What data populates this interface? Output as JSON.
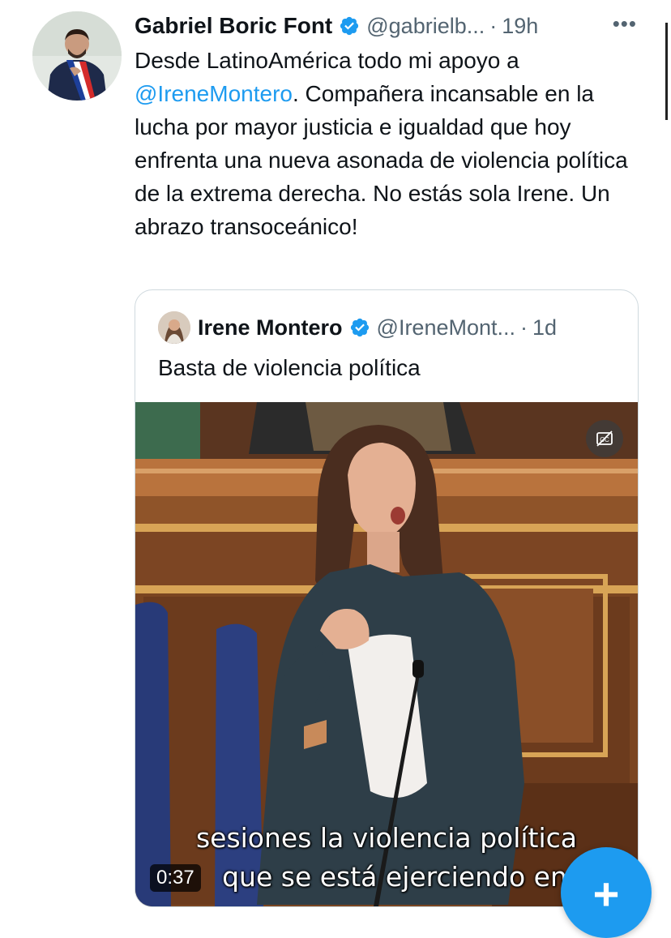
{
  "tweet": {
    "author_name": "Gabriel Boric Font",
    "author_handle": "@gabrielb...",
    "separator": "·",
    "time": "19h",
    "more": "•••",
    "text_line1": "Desde LatinoAmérica todo mi apoyo a",
    "mention": "@IreneMontero",
    "text_rest": ". Compañera incansable en la lucha por mayor justicia e igualdad que hoy enfrenta una nueva asonada de violencia política de la extrema derecha. No estás sola Irene. Un abrazo transoceánico!"
  },
  "quoted": {
    "author_name": "Irene Montero",
    "author_handle": "@IreneMont...",
    "separator": "·",
    "time": "1d",
    "text": "Basta de violencia política",
    "video": {
      "subtitle_line1": "sesiones la violencia política",
      "subtitle_line2": "que se está ejerciendo en",
      "duration": "0:37"
    }
  },
  "fab": {
    "label": "+"
  },
  "colors": {
    "accent": "#1d9bf0",
    "text": "#0f1419",
    "muted": "#536471",
    "border": "#cfd9de"
  }
}
